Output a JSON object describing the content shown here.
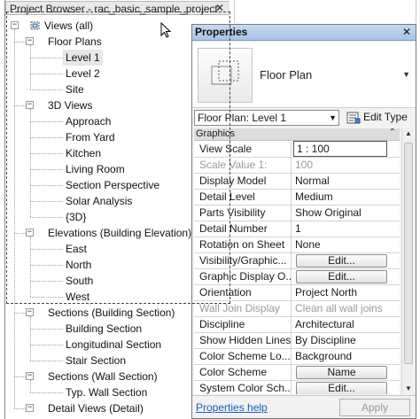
{
  "project_browser": {
    "title": "Project Browser - rac_basic_sample_project",
    "close": "✕",
    "tree": [
      {
        "label": "Views (all)",
        "level": 0,
        "toggle": "−",
        "icon": "views-icon"
      },
      {
        "label": "Floor Plans",
        "level": 1,
        "toggle": "−"
      },
      {
        "label": "Level 1",
        "level": 2,
        "selected": true
      },
      {
        "label": "Level 2",
        "level": 2
      },
      {
        "label": "Site",
        "level": 2
      },
      {
        "label": "3D Views",
        "level": 1,
        "toggle": "−"
      },
      {
        "label": "Approach",
        "level": 2
      },
      {
        "label": "From Yard",
        "level": 2
      },
      {
        "label": "Kitchen",
        "level": 2
      },
      {
        "label": "Living Room",
        "level": 2
      },
      {
        "label": "Section Perspective",
        "level": 2
      },
      {
        "label": "Solar Analysis",
        "level": 2
      },
      {
        "label": "{3D}",
        "level": 2
      },
      {
        "label": "Elevations (Building Elevation)",
        "level": 1,
        "toggle": "−"
      },
      {
        "label": "East",
        "level": 2
      },
      {
        "label": "North",
        "level": 2
      },
      {
        "label": "South",
        "level": 2
      },
      {
        "label": "West",
        "level": 2
      },
      {
        "label": "Sections (Building Section)",
        "level": 1,
        "toggle": "−"
      },
      {
        "label": "Building Section",
        "level": 2
      },
      {
        "label": "Longitudinal Section",
        "level": 2
      },
      {
        "label": "Stair Section",
        "level": 2
      },
      {
        "label": "Sections (Wall Section)",
        "level": 1,
        "toggle": "−"
      },
      {
        "label": "Typ. Wall Section",
        "level": 2
      },
      {
        "label": "Detail Views (Detail)",
        "level": 1,
        "toggle": "−"
      }
    ]
  },
  "properties": {
    "title": "Properties",
    "close": "✕",
    "type_name": "Floor Plan",
    "type_arrow": "▼",
    "instance_selector": "Floor Plan: Level 1",
    "instance_arrow": "▼",
    "edit_type": "Edit Type",
    "group": "Graphics",
    "group_toggle": "⌃",
    "rows": [
      {
        "name": "View Scale",
        "value": "1 : 100",
        "kind": "input"
      },
      {
        "name": "Scale Value    1:",
        "value": "100",
        "kind": "disabled"
      },
      {
        "name": "Display Model",
        "value": "Normal"
      },
      {
        "name": "Detail Level",
        "value": "Medium"
      },
      {
        "name": "Parts Visibility",
        "value": "Show Original"
      },
      {
        "name": "Detail Number",
        "value": "1"
      },
      {
        "name": "Rotation on Sheet",
        "value": "None"
      },
      {
        "name": "Visibility/Graphic...",
        "value": "Edit...",
        "kind": "button"
      },
      {
        "name": "Graphic Display O...",
        "value": "Edit...",
        "kind": "button"
      },
      {
        "name": "Orientation",
        "value": "Project North"
      },
      {
        "name": "Wall Join Display",
        "value": "Clean all wall joins",
        "kind": "disabled"
      },
      {
        "name": "Discipline",
        "value": "Architectural"
      },
      {
        "name": "Show Hidden Lines",
        "value": "By Discipline"
      },
      {
        "name": "Color Scheme Lo...",
        "value": "Background"
      },
      {
        "name": "Color Scheme",
        "value": "Name",
        "kind": "button"
      },
      {
        "name": "System Color Sch...",
        "value": "Edit...",
        "kind": "button"
      }
    ],
    "help_link": "Properties help",
    "apply": "Apply"
  }
}
